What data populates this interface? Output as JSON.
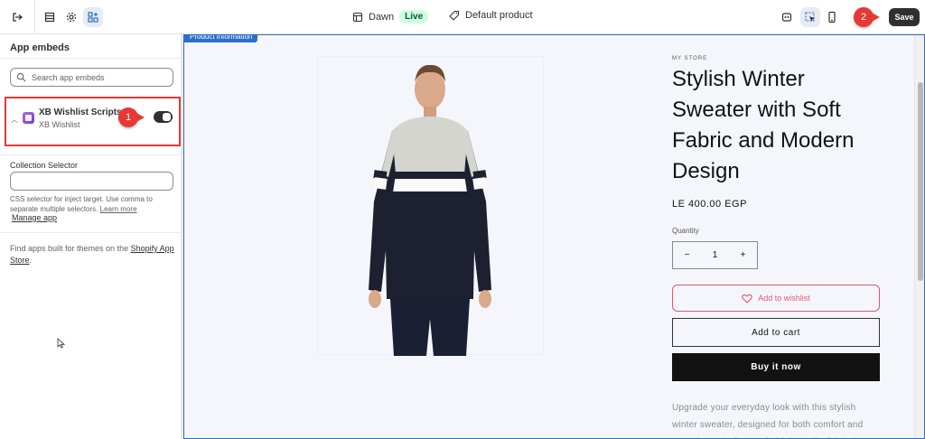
{
  "topbar": {
    "theme_name": "Dawn",
    "theme_status": "Live",
    "template_name": "Default product",
    "save_label": "Save"
  },
  "markers": {
    "first": "1",
    "second": "2"
  },
  "sidebar": {
    "title": "App embeds",
    "search_placeholder": "Search app embeds",
    "embed": {
      "name": "XB Wishlist Scripts",
      "app": "XB Wishlist",
      "enabled": true
    },
    "collection_label": "Collection Selector",
    "collection_value": "",
    "help_text": "CSS selector for inject target. Use comma to separate multiple selectors.",
    "learn_more": "Learn more",
    "manage_app": "Manage app",
    "find_text": "Find apps built for themes on the",
    "find_link": "Shopify App Store",
    "find_end": "."
  },
  "preview": {
    "section_tag": "Product information",
    "store": "MY STORE",
    "title": "Stylish Winter Sweater with Soft Fabric and Modern Design",
    "price": "LE 400.00 EGP",
    "quantity_label": "Quantity",
    "quantity_minus": "−",
    "quantity_value": "1",
    "quantity_plus": "+",
    "wishlist_label": "Add to wishlist",
    "cart_label": "Add to cart",
    "buy_label": "Buy it now",
    "description": "Upgrade your everyday look with this stylish winter sweater, designed for both comfort and warmth. Made from soft, high-quality fabric it"
  },
  "colors": {
    "accent": "#2c6ecb",
    "marker": "#e53935",
    "wishlist": "#e0596b",
    "dark": "#303030"
  }
}
